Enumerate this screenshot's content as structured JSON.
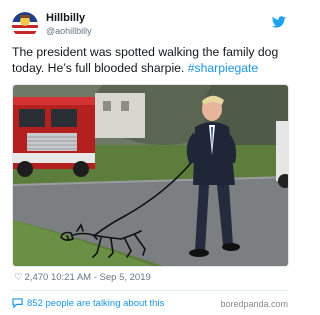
{
  "tweet": {
    "display_name": "Hillbilly",
    "handle": "@aohillbilly",
    "text_main": "The president was spotted walking the family dog today. He’s full blooded sharpie.",
    "hashtag": "#sharpiegate",
    "likes": "2,470",
    "timestamp": "10:21 AM - Sep 5, 2019",
    "talking": "852 people are talking about this"
  },
  "watermark": "boredpanda.com",
  "colors": {
    "link": "#1b95e0",
    "muted": "#657786",
    "twitter_blue": "#1da1f2"
  },
  "icons": {
    "brand": "twitter-bird-icon",
    "like": "heart-icon",
    "talking": "speech-bubble-icon"
  }
}
